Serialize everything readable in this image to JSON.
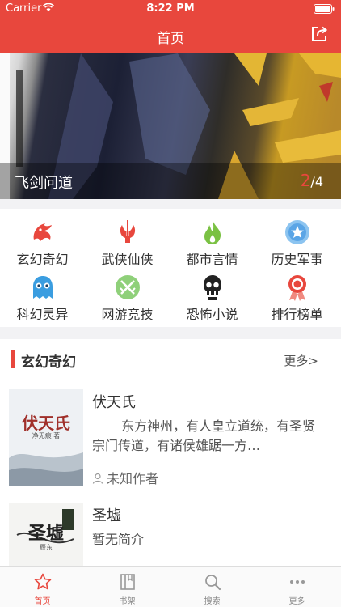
{
  "status_bar": {
    "carrier": "Carrier",
    "time": "8:22 PM"
  },
  "nav": {
    "title": "首页",
    "share_icon": "share-icon"
  },
  "banner": {
    "title": "飞剑问道",
    "current_page": "2",
    "total_pages": "/4"
  },
  "categories": [
    {
      "label": "玄幻奇幻",
      "icon": "dragon-icon",
      "color": "#e8473d"
    },
    {
      "label": "武侠仙侠",
      "icon": "sword-icon",
      "color": "#e8473d"
    },
    {
      "label": "都市言情",
      "icon": "flame-icon",
      "color": "#7ac143"
    },
    {
      "label": "历史军事",
      "icon": "shield-star-icon",
      "color": "#5aa5e6"
    },
    {
      "label": "科幻灵异",
      "icon": "ghost-icon",
      "color": "#3a9de0"
    },
    {
      "label": "网游竞技",
      "icon": "crossed-swords-icon",
      "color": "#8fd07a"
    },
    {
      "label": "恐怖小说",
      "icon": "skull-icon",
      "color": "#222222"
    },
    {
      "label": "排行榜单",
      "icon": "medal-icon",
      "color": "#e8473d"
    }
  ],
  "section": {
    "title": "玄幻奇幻",
    "more": "更多>",
    "books": [
      {
        "title": "伏天氏",
        "description": "东方神州，有人皇立道统，有圣贤宗门传道，有诸侯雄踞一方…",
        "author": "未知作者",
        "cover_title": "伏天氏",
        "cover_subtitle": "净无痕 著"
      },
      {
        "title": "圣墟",
        "description": "暂无简介",
        "cover_title": "圣墟",
        "cover_subtitle": "辰东"
      }
    ]
  },
  "tabbar": [
    {
      "label": "首页",
      "icon": "star-icon",
      "active": true
    },
    {
      "label": "书架",
      "icon": "bookshelf-icon",
      "active": false
    },
    {
      "label": "搜索",
      "icon": "search-icon",
      "active": false
    },
    {
      "label": "更多",
      "icon": "more-dots-icon",
      "active": false
    }
  ],
  "colors": {
    "accent": "#e8473d",
    "background": "#f2f2f4"
  }
}
